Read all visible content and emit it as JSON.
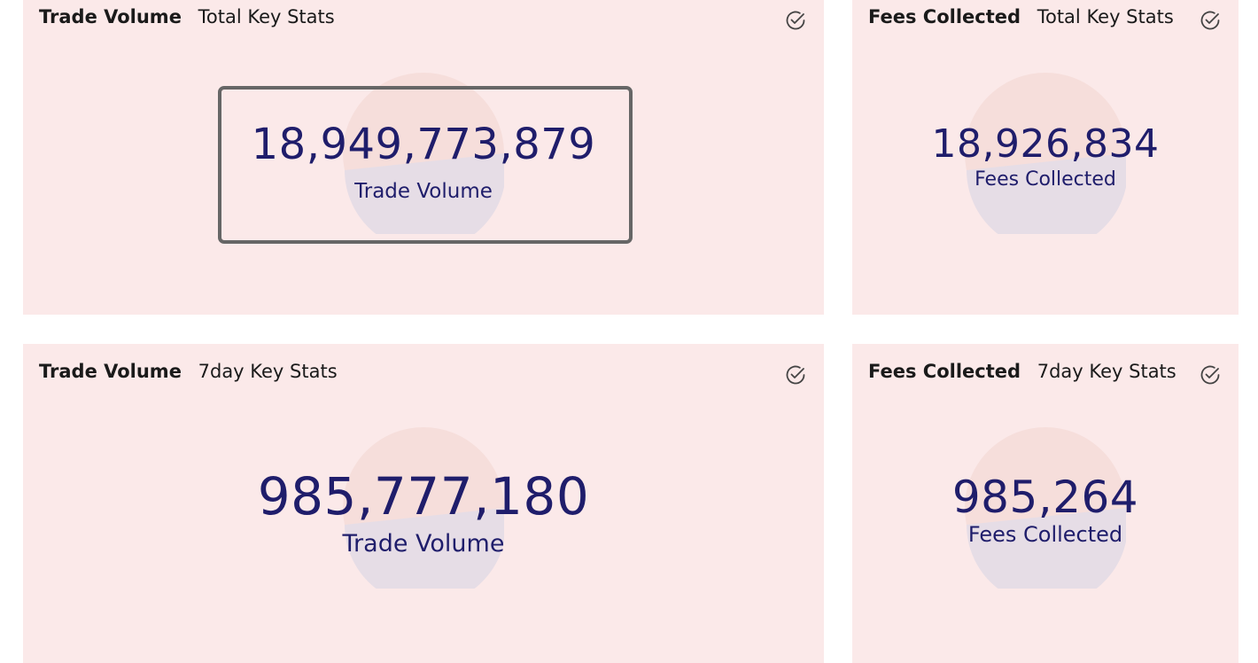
{
  "colors": {
    "card_background": "#fbe9e9",
    "value_text": "#1f1d6b",
    "pie_primary": "#f6dedb",
    "pie_secondary": "#e6dde6",
    "focus_outline": "#666666"
  },
  "cards": [
    {
      "title": "Trade Volume",
      "subtitle": "Total Key Stats",
      "value": "18,949,773,879",
      "caption": "Trade Volume",
      "icon": "check-circle-icon",
      "focused": true
    },
    {
      "title": "Fees Collected",
      "subtitle": "Total Key Stats",
      "value": "18,926,834",
      "caption": "Fees Collected",
      "icon": "check-circle-icon",
      "focused": false
    },
    {
      "title": "Trade Volume",
      "subtitle": "7day Key Stats",
      "value": "985,777,180",
      "caption": "Trade Volume",
      "icon": "check-circle-icon",
      "focused": false
    },
    {
      "title": "Fees Collected",
      "subtitle": "7day Key Stats",
      "value": "985,264",
      "caption": "Fees Collected",
      "icon": "check-circle-icon",
      "focused": false
    }
  ]
}
